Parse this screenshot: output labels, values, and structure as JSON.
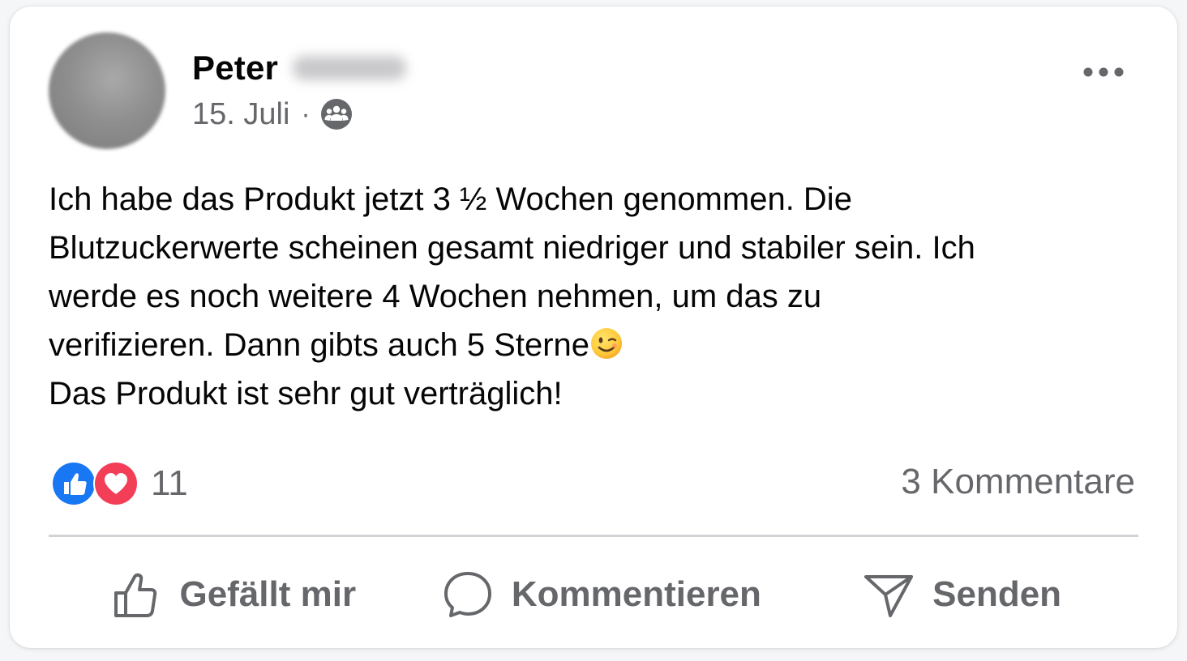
{
  "post": {
    "author": {
      "name": "Peter",
      "avatar_icon": "avatar-blurred"
    },
    "date": "15. Juli",
    "separator": "·",
    "audience_icon": "group-icon",
    "text": "Ich habe das Produkt jetzt 3 ½ Wochen genommen. Die\nBlutzuckerwerte scheinen gesamt niedriger und stabiler sein. Ich\nwerde es noch weitere 4 Wochen nehmen, um das zu\nverifizieren. Dann gibts auch 5 Sterne",
    "text_after_emoji": "\nDas Produkt ist sehr gut verträglich!",
    "emoji": "winking-face",
    "reactions": {
      "types": [
        "like",
        "love"
      ],
      "count": "11"
    },
    "comments_label": "3 Kommentare"
  },
  "actions": {
    "like_label": "Gefällt mir",
    "comment_label": "Kommentieren",
    "send_label": "Senden"
  },
  "colors": {
    "text_primary": "#050505",
    "text_secondary": "#65676b",
    "like_blue": "#1877f2",
    "love_red": "#f33e58",
    "divider": "#d0d2d6"
  }
}
